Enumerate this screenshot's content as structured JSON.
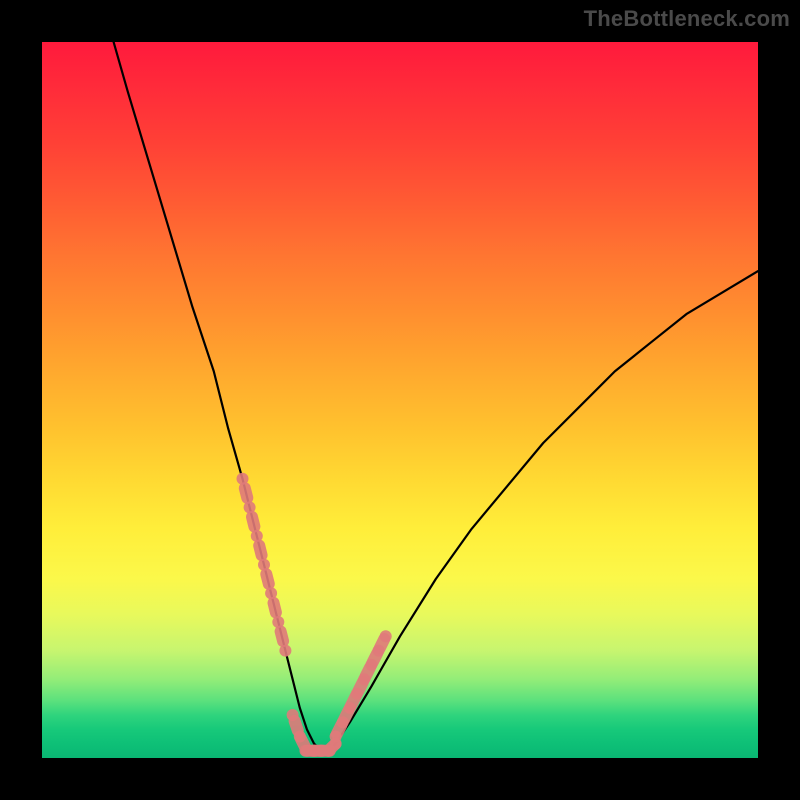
{
  "watermark": "TheBottleneck.com",
  "chart_data": {
    "type": "line",
    "title": "",
    "xlabel": "",
    "ylabel": "",
    "xlim": [
      0,
      100
    ],
    "ylim": [
      0,
      100
    ],
    "series": [
      {
        "name": "bottleneck-curve",
        "x": [
          10,
          12,
          15,
          18,
          21,
          24,
          26,
          28,
          30,
          31,
          32,
          33,
          34,
          35,
          36,
          37,
          38,
          39,
          40,
          41,
          43,
          46,
          50,
          55,
          60,
          65,
          70,
          75,
          80,
          85,
          90,
          95,
          100
        ],
        "values": [
          100,
          93,
          83,
          73,
          63,
          54,
          46,
          39,
          31,
          27,
          23,
          19,
          15,
          11,
          7,
          4,
          2,
          1,
          1,
          2,
          5,
          10,
          17,
          25,
          32,
          38,
          44,
          49,
          54,
          58,
          62,
          65,
          68
        ]
      },
      {
        "name": "highlight-left",
        "x": [
          28,
          29,
          30,
          31,
          32,
          33,
          34
        ],
        "values": [
          39,
          35,
          31,
          27,
          23,
          19,
          15
        ]
      },
      {
        "name": "highlight-bottom",
        "x": [
          35,
          36,
          37,
          38,
          39,
          40,
          41
        ],
        "values": [
          6,
          3,
          1,
          1,
          1,
          1,
          2
        ]
      },
      {
        "name": "highlight-right",
        "x": [
          41,
          42,
          43,
          44,
          45,
          46,
          47,
          48
        ],
        "values": [
          3,
          5,
          7,
          9,
          11,
          13,
          15,
          17
        ]
      }
    ],
    "colors": {
      "curve": "#000000",
      "highlight": "#e07a7a"
    },
    "gradient_stops": [
      {
        "pos": 0,
        "color": "#ff1a3c"
      },
      {
        "pos": 50,
        "color": "#ffbf2f"
      },
      {
        "pos": 75,
        "color": "#fff647"
      },
      {
        "pos": 100,
        "color": "#0ab773"
      }
    ]
  }
}
